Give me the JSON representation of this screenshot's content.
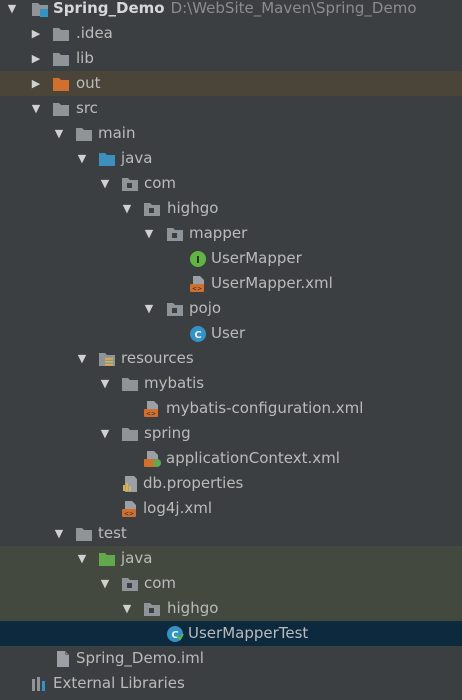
{
  "project": {
    "name": "Spring_Demo",
    "path": "D:\\WebSite_Maven\\Spring_Demo"
  },
  "tree": {
    "idea": ".idea",
    "lib": "lib",
    "out": "out",
    "src": "src",
    "main": "main",
    "java": "java",
    "com": "com",
    "highgo": "highgo",
    "mapper": "mapper",
    "user_mapper": "UserMapper",
    "user_mapper_xml": "UserMapper.xml",
    "pojo": "pojo",
    "user": "User",
    "resources": "resources",
    "mybatis": "mybatis",
    "mybatis_cfg": "mybatis-configuration.xml",
    "spring": "spring",
    "app_ctx": "applicationContext.xml",
    "db_props": "db.properties",
    "log4j": "log4j.xml",
    "test": "test",
    "test_java": "java",
    "test_com": "com",
    "test_highgo": "highgo",
    "user_mapper_test": "UserMapperTest",
    "iml": "Spring_Demo.iml",
    "external_libraries": "External Libraries"
  },
  "colors": {
    "background": "#3c3f41",
    "folder": "#8f9499",
    "source_folder": "#3d8fbf",
    "test_folder": "#62a84c",
    "excluded_folder": "#d0702f",
    "interface_icon": "#62b543",
    "class_icon": "#3592c4",
    "selected_row": "#0d293e"
  },
  "icons": {
    "expanded": "chevron-down-icon",
    "collapsed": "chevron-right-icon",
    "folder": "folder-icon",
    "package": "package-icon",
    "module": "module-icon",
    "interface": "interface-icon",
    "class": "class-icon",
    "xml": "xml-file-icon",
    "properties": "properties-file-icon",
    "iml": "iml-file-icon"
  }
}
